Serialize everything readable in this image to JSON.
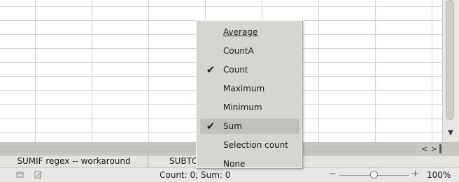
{
  "context_menu": {
    "items": [
      {
        "label": "Average",
        "checked": false,
        "highlighted": false
      },
      {
        "label": "CountA",
        "checked": false,
        "highlighted": false
      },
      {
        "label": "Count",
        "checked": true,
        "highlighted": false
      },
      {
        "label": "Maximum",
        "checked": false,
        "highlighted": false
      },
      {
        "label": "Minimum",
        "checked": false,
        "highlighted": false
      },
      {
        "label": "Sum",
        "checked": true,
        "highlighted": true
      },
      {
        "label": "Selection count",
        "checked": false,
        "highlighted": false
      },
      {
        "label": "None",
        "checked": false,
        "highlighted": false
      }
    ],
    "check_glyph": "✔"
  },
  "sheet_tabs": [
    {
      "label": "SUMIF regex -- workaround"
    },
    {
      "label": "SUBTOTAL"
    }
  ],
  "status_bar": {
    "summary": "Count: 0; Sum: 0",
    "zoom_minus": "−",
    "zoom_plus": "+",
    "zoom_level": "100%",
    "zoom_fraction": 0.5
  },
  "scroll": {
    "prev_sheet": "<",
    "next_sheet": ">",
    "up_arrow": "▲",
    "down_arrow": "▼"
  },
  "icons": {
    "status_left": "document-status-icon",
    "status_edit": "document-modified-icon"
  },
  "colors": {
    "menu_bg": "#d7d5d1",
    "menu_highlight": "#c2c0bc",
    "grid_line": "#d4d4d4",
    "status_bg": "#e8e7e5"
  }
}
